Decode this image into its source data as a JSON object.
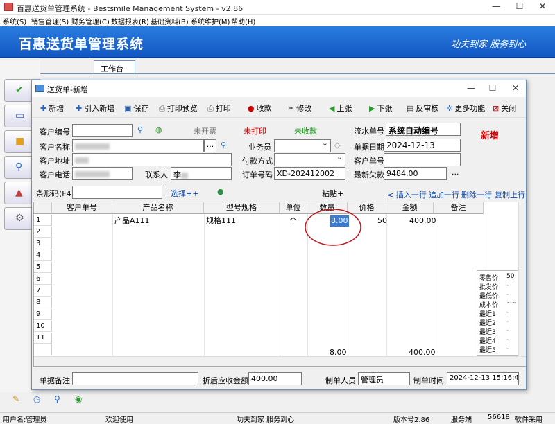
{
  "app": {
    "window_title": "百惠送货单管理系统 - Bestsmile Management System - v2.86",
    "menu": [
      "系统(S)",
      "销售管理(S)",
      "财务管理(C)",
      "数据报表(R)",
      "基础资料(B)",
      "系统维护(M)",
      "帮助(H)"
    ],
    "banner_title": "百惠送货单管理系统",
    "banner_slogan": "功夫到家  服务到心",
    "workspace_tab": "工作台"
  },
  "dialog": {
    "title": "送货单-新增",
    "toolbar": {
      "add": "新增",
      "import_add": "引入新增",
      "save": "保存",
      "print_preview": "打印预览",
      "print": "打印",
      "collect": "收款",
      "modify": "修改",
      "prev": "上张",
      "next": "下张",
      "unapprove": "反审核",
      "more": "更多功能",
      "close": "关闭"
    },
    "form": {
      "customer_code_label": "客户编号",
      "customer_name_label": "客户名称",
      "customer_address_label": "客户地址",
      "customer_phone_label": "客户电话",
      "contact_label": "联系人",
      "contact_prefix": "李",
      "status_invoice": "未开票",
      "status_print": "未打印",
      "status_collect": "未收款",
      "salesperson_label": "业务员",
      "payment_label": "付款方式",
      "order_no_label": "订单号码",
      "order_no": "XD-202412002",
      "serial_label": "流水单号",
      "serial_value": "系统自动编号",
      "date_label": "单据日期",
      "date_value": "2024-12-13",
      "customer_doc_label": "客户单号",
      "latest_debt_label": "最新欠款",
      "latest_debt": "9484.00",
      "mode_badge": "新增",
      "more_dots": "..."
    },
    "barcode": {
      "label": "条形码(F4)",
      "select": "选择++",
      "paste": "粘贴+",
      "insert_row": "< 插入一行",
      "append_row": "追加一行",
      "delete_row": "删除一行",
      "copy_row": "复制上行"
    },
    "grid": {
      "headers": [
        "客户单号",
        "产品名称",
        "型号规格",
        "单位",
        "数量",
        "价格",
        "金额",
        "备注"
      ],
      "row_numbers": [
        "1",
        "2",
        "3",
        "4",
        "5",
        "6",
        "7",
        "8",
        "9",
        "10",
        "11"
      ],
      "row1": {
        "product": "产品A111",
        "spec": "规格111",
        "unit": "个",
        "qty": "8.00",
        "price": "50",
        "amount": "400.00"
      },
      "total_qty": "8.00",
      "total_amount": "400.00"
    },
    "price_panel": [
      {
        "label": "零售价",
        "value": "50"
      },
      {
        "label": "批发价",
        "value": "-"
      },
      {
        "label": "最低价",
        "value": "-"
      },
      {
        "label": "成本价",
        "value": "~~"
      },
      {
        "label": "最近1",
        "value": "-"
      },
      {
        "label": "最近2",
        "value": "-"
      },
      {
        "label": "最近3",
        "value": "-"
      },
      {
        "label": "最近4",
        "value": "-"
      },
      {
        "label": "最近5",
        "value": "-"
      }
    ],
    "footer": {
      "remark_label": "单据备注",
      "receivable_label": "折后应收金额",
      "receivable": "400.00",
      "creator_label": "制单人员",
      "creator": "管理员",
      "created_time_label": "制单时间",
      "created_time": "2024-12-13 15:16:41"
    }
  },
  "statusbar": {
    "user": "用户名:管理员",
    "welcome": "欢迎使用",
    "slogan": "功夫到家 服务到心",
    "version": "版本号2.86",
    "server": "服务端",
    "port": "56618",
    "software": "软件采用"
  },
  "colors": {
    "banner": "#1a66d0",
    "highlight_circle": "#c0151b",
    "selection": "#3a7bd5"
  }
}
